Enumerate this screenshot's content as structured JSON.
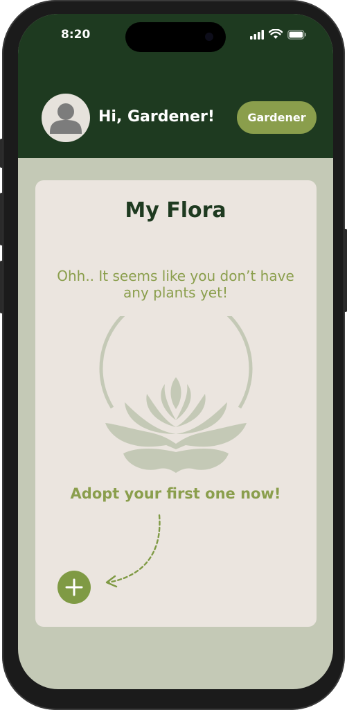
{
  "status_bar": {
    "time": "8:20",
    "icons": [
      "signal-icon",
      "wifi-icon",
      "battery-icon"
    ]
  },
  "header": {
    "greeting": "Hi, Gardener!",
    "role_label": "Gardener",
    "avatar_icon": "person-icon"
  },
  "card": {
    "title": "My Flora",
    "empty_message": "Ohh.. It seems like you don’t have any plants yet!",
    "illustration": "lotus-icon",
    "cta": "Adopt your first one now!",
    "add_icon": "plus-icon"
  },
  "colors": {
    "header_bg": "#1e3a20",
    "screen_bg": "#c4c9b6",
    "card_bg": "#ebe5df",
    "accent": "#8a9e4c",
    "title": "#1e3a20"
  }
}
